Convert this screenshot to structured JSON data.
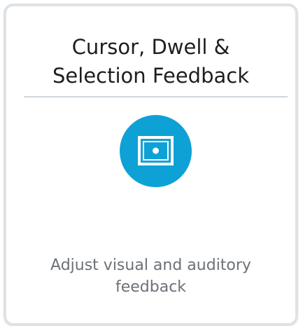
{
  "card": {
    "title_line1": "Cursor, Dwell &",
    "title_line2": "Selection Feedback",
    "description_line1": "Adjust visual and auditory",
    "description_line2": "feedback",
    "icon": "screen-frame-icon",
    "accent_color": "#0ea1d6"
  }
}
